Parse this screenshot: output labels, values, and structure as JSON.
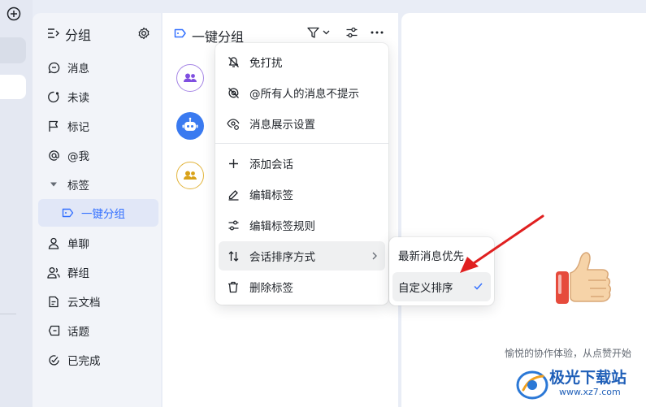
{
  "nav": {
    "title": "分组",
    "items": [
      {
        "label": "消息",
        "icon": "chat-bubble-icon"
      },
      {
        "label": "未读",
        "icon": "unread-icon"
      },
      {
        "label": "标记",
        "icon": "flag-icon"
      },
      {
        "label": "@我",
        "icon": "at-icon"
      },
      {
        "label": "标签",
        "icon": "caret-down-icon"
      },
      {
        "label": "一键分组",
        "icon": "tag-icon"
      },
      {
        "label": "单聊",
        "icon": "person-icon"
      },
      {
        "label": "群组",
        "icon": "group-icon"
      },
      {
        "label": "云文档",
        "icon": "doc-icon"
      },
      {
        "label": "话题",
        "icon": "topic-icon"
      },
      {
        "label": "已完成",
        "icon": "check-circle-icon"
      }
    ]
  },
  "list": {
    "title": "一键分组"
  },
  "context_menu": {
    "items": [
      {
        "label": "免打扰",
        "icon": "bell-off-icon"
      },
      {
        "label": "@所有人的消息不提示",
        "icon": "at-off-icon"
      },
      {
        "label": "消息展示设置",
        "icon": "eye-settings-icon"
      },
      {
        "label": "添加会话",
        "icon": "plus-icon"
      },
      {
        "label": "编辑标签",
        "icon": "pencil-icon"
      },
      {
        "label": "编辑标签规则",
        "icon": "sliders-icon"
      },
      {
        "label": "会话排序方式",
        "icon": "sort-icon"
      },
      {
        "label": "删除标签",
        "icon": "trash-icon"
      }
    ]
  },
  "submenu": {
    "items": [
      {
        "label": "最新消息优先",
        "selected": false
      },
      {
        "label": "自定义排序",
        "selected": true
      }
    ]
  },
  "right": {
    "caption": "愉悦的协作体验，从点赞开始"
  },
  "watermark": {
    "name": "极光下载站",
    "url": "www.xz7.com"
  },
  "colors": {
    "accent": "#3370ff",
    "arrow": "#e02020",
    "nav_bg": "#f2f4f9"
  }
}
